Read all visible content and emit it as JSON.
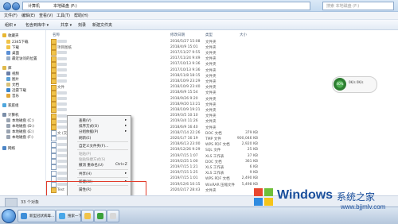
{
  "address_bar": {
    "segments": [
      "计算机",
      "本地磁盘 (F:)"
    ],
    "search_placeholder": "搜索 本地磁盘 (F:)"
  },
  "menu": [
    "文件(F)",
    "编辑(E)",
    "查看(V)",
    "工具(T)",
    "帮助(H)"
  ],
  "toolbar": [
    "组织 ▾",
    "包含到库中 ▾",
    "共享 ▾",
    "刻录",
    "新建文件夹"
  ],
  "sidebar": [
    {
      "label": "收藏夹",
      "icon": "star-icon",
      "color": "#e8b630"
    },
    {
      "label": "2345下载",
      "icon": "folder-icon",
      "color": "#f0c34a"
    },
    {
      "label": "下载",
      "icon": "download-folder-icon",
      "color": "#f0c34a"
    },
    {
      "label": "桌面",
      "icon": "desktop-icon",
      "color": "#5a8fd6"
    },
    {
      "label": "最近访问的位置",
      "icon": "recent-icon",
      "color": "#9aaec6"
    },
    {
      "label": "库",
      "icon": "library-icon",
      "color": "#e0b94a"
    },
    {
      "label": "视频",
      "icon": "video-icon",
      "color": "#6a7fa8"
    },
    {
      "label": "图片",
      "icon": "pictures-icon",
      "color": "#5da2d8"
    },
    {
      "label": "文档",
      "icon": "documents-icon",
      "color": "#d9c27a"
    },
    {
      "label": "迅雷下载",
      "icon": "thunder-icon",
      "color": "#3a86d1"
    },
    {
      "label": "音乐",
      "icon": "music-icon",
      "color": "#e3a93a"
    },
    {
      "label": "家庭组",
      "icon": "homegroup-icon",
      "color": "#4ea6dd"
    },
    {
      "label": "计算机",
      "icon": "computer-icon",
      "color": "#7b8ea8"
    },
    {
      "label": "本地磁盘 (C:)",
      "icon": "drive-icon",
      "color": "#9aa4b2"
    },
    {
      "label": "本地磁盘 (D:)",
      "icon": "drive-icon",
      "color": "#9aa4b2"
    },
    {
      "label": "本地磁盘 (E:)",
      "icon": "drive-icon",
      "color": "#9aa4b2"
    },
    {
      "label": "本地磁盘 (F:)",
      "icon": "drive-icon",
      "color": "#9aa4b2"
    },
    {
      "label": "网络",
      "icon": "network-icon",
      "color": "#4d86c6"
    }
  ],
  "columns": {
    "name": "名称",
    "date": "修改日期",
    "type": "类型",
    "size": "大小"
  },
  "files": [
    {
      "name": "",
      "date": "2016/5/27 15:08",
      "type": "文件夹",
      "size": "",
      "kind": "folder"
    },
    {
      "name": "项目图纸",
      "date": "2018/4/9 15:01",
      "type": "文件夹",
      "size": "",
      "kind": "folder"
    },
    {
      "name": "",
      "date": "2017/11/27 9:55",
      "type": "文件夹",
      "size": "",
      "kind": "folder"
    },
    {
      "name": "",
      "date": "2017/11/24 9:49",
      "type": "文件夹",
      "size": "",
      "kind": "folder"
    },
    {
      "name": "",
      "date": "2017/10/13 9:36",
      "type": "文件夹",
      "size": "",
      "kind": "folder"
    },
    {
      "name": "",
      "date": "2017/10/13 9:36",
      "type": "文件夹",
      "size": "",
      "kind": "folder"
    },
    {
      "name": "",
      "date": "2018/11/8 18:15",
      "type": "文件夹",
      "size": "",
      "kind": "folder"
    },
    {
      "name": "",
      "date": "2018/10/9 23:29",
      "type": "文件夹",
      "size": "",
      "kind": "folder"
    },
    {
      "name": "文件",
      "date": "2018/10/9 23:40",
      "type": "文件夹",
      "size": "",
      "kind": "folder"
    },
    {
      "name": "",
      "date": "2018/6/9 15:54",
      "type": "文件夹",
      "size": "",
      "kind": "folder"
    },
    {
      "name": "",
      "date": "2018/9/26 9:20",
      "type": "文件夹",
      "size": "",
      "kind": "folder"
    },
    {
      "name": "",
      "date": "2018/9/20 13:21",
      "type": "文件夹",
      "size": "",
      "kind": "folder"
    },
    {
      "name": "",
      "date": "2018/10/9 19:21",
      "type": "文件夹",
      "size": "",
      "kind": "folder"
    },
    {
      "name": "",
      "date": "2019/3/5 10:10",
      "type": "文件夹",
      "size": "",
      "kind": "folder"
    },
    {
      "name": "",
      "date": "2019/3/4 11:26",
      "type": "文件夹",
      "size": "",
      "kind": "folder"
    },
    {
      "name": "",
      "date": "2018/6/9 16:40",
      "type": "文件夹",
      "size": "",
      "kind": "folder"
    },
    {
      "name": "文 (交出受费标准).doc",
      "date": "2018/7/14 22:26",
      "type": "DOC 文档",
      "size": "379 KB",
      "kind": "doc"
    },
    {
      "name": "",
      "date": "2020/1/7 16:19",
      "type": "TMP 文件",
      "size": "900,046 KB",
      "kind": "doc"
    },
    {
      "name": "",
      "date": "2018/6/13 23:00",
      "type": "WPS PDF 文档",
      "size": "2,920 KB",
      "kind": "doc"
    },
    {
      "name": "",
      "date": "2019/12/26 9:29",
      "type": "SQL 文件",
      "size": "25 KB",
      "kind": "doc"
    },
    {
      "name": "",
      "date": "2019/7/15 1:07",
      "type": "XLS 工作表",
      "size": "37 KB",
      "kind": "doc"
    },
    {
      "name": "",
      "date": "2019/2/25 1:00",
      "type": "DOC 文档",
      "size": "361 KB",
      "kind": "doc"
    },
    {
      "name": "",
      "date": "2019/7/15 1:21",
      "type": "XLS 工作表",
      "size": "6 KB",
      "kind": "doc"
    },
    {
      "name": "",
      "date": "2019/7/15 1:25",
      "type": "XLS 工作表",
      "size": "9 KB",
      "kind": "doc"
    },
    {
      "name": "",
      "date": "2019/7/15 1:01",
      "type": "WPS PDF 文档",
      "size": "2,490 KB",
      "kind": "doc"
    },
    {
      "name": "",
      "date": "2019/12/6 10:15",
      "type": "WinRAR 压缩文件",
      "size": "5,498 KB",
      "kind": "doc"
    },
    {
      "name": "Test",
      "date": "2020/2/17 28:43",
      "type": "文件夹",
      "size": "",
      "kind": "folder"
    }
  ],
  "context_menu": [
    {
      "label": "查看(V)",
      "shortcut": "",
      "arrow": "▸",
      "disabled": false
    },
    {
      "label": "排序方式(O)",
      "shortcut": "",
      "arrow": "▸",
      "disabled": false
    },
    {
      "label": "分组依据(P)",
      "shortcut": "",
      "arrow": "▸",
      "disabled": false
    },
    {
      "label": "刷新(E)",
      "shortcut": "",
      "arrow": "",
      "disabled": false
    },
    {
      "sep": true
    },
    {
      "label": "自定义文件夹(F)...",
      "shortcut": "",
      "arrow": "",
      "disabled": false
    },
    {
      "sep": true
    },
    {
      "label": "粘贴(P)",
      "shortcut": "",
      "arrow": "",
      "disabled": true
    },
    {
      "label": "粘贴快捷方式(S)",
      "shortcut": "",
      "arrow": "",
      "disabled": true
    },
    {
      "label": "撤消 重命名(U)",
      "shortcut": "Ctrl+Z",
      "arrow": "",
      "disabled": false
    },
    {
      "sep": true
    },
    {
      "label": "共享(H)",
      "shortcut": "",
      "arrow": "▸",
      "disabled": false
    },
    {
      "sep": true
    },
    {
      "label": "新建(W)",
      "shortcut": "",
      "arrow": "▸",
      "disabled": false
    },
    {
      "sep": true
    },
    {
      "label": "属性(R)",
      "shortcut": "",
      "arrow": "",
      "disabled": false
    }
  ],
  "status": "33 个对象",
  "widget": {
    "percent": "40%",
    "stat1": "0K/s",
    "stat2": "0K/s"
  },
  "taskbar": [
    {
      "label": "新型冠状病毒...",
      "color": "#3e8ed8"
    },
    {
      "label": "搜索一下",
      "color": "#49a7e8"
    },
    {
      "label": "",
      "color": "#f0c34a"
    },
    {
      "label": "",
      "color": "#3aa13a"
    },
    {
      "label": "",
      "color": "#d8d8d8"
    }
  ],
  "watermark": {
    "brand": "Windows",
    "cn": "系统之家",
    "url": "www.bjjmlv.com"
  }
}
